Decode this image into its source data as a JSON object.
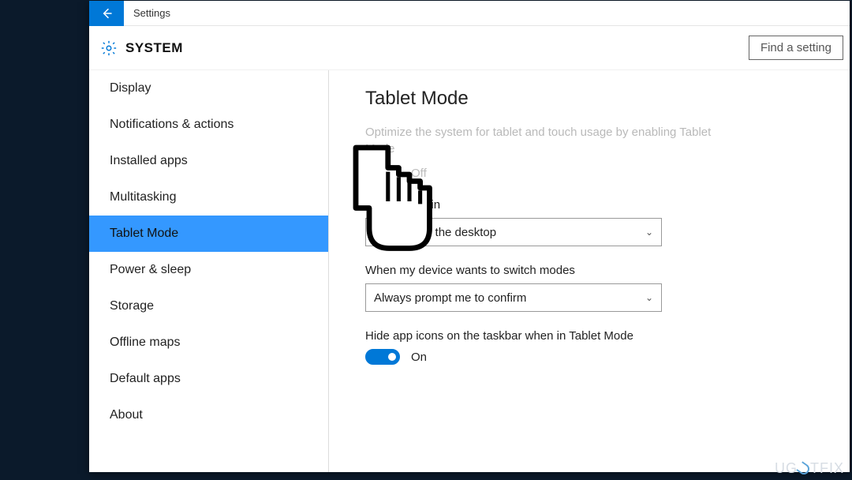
{
  "title_bar": {
    "title": "Settings"
  },
  "header": {
    "title": "SYSTEM",
    "search_label": "Find a setting"
  },
  "sidebar": {
    "items": [
      {
        "label": "Display",
        "active": false
      },
      {
        "label": "Notifications & actions",
        "active": false
      },
      {
        "label": "Installed apps",
        "active": false
      },
      {
        "label": "Multitasking",
        "active": false
      },
      {
        "label": "Tablet Mode",
        "active": true
      },
      {
        "label": "Power & sleep",
        "active": false
      },
      {
        "label": "Storage",
        "active": false
      },
      {
        "label": "Offline maps",
        "active": false
      },
      {
        "label": "Default apps",
        "active": false
      },
      {
        "label": "About",
        "active": false
      }
    ]
  },
  "content": {
    "page_title": "Tablet Mode",
    "description": "Optimize the system for tablet and touch usage by enabling Tablet Mode",
    "toggle1": {
      "state": "off",
      "label": "Off"
    },
    "field1": {
      "label": "When I sign in",
      "value": "Take me to the desktop"
    },
    "field2": {
      "label": "When my device wants to switch modes",
      "value": "Always prompt me to confirm"
    },
    "field3": {
      "label": "Hide app icons on the taskbar when in Tablet Mode"
    },
    "toggle2": {
      "state": "on",
      "label": "On"
    }
  },
  "watermark": "UGETFIX"
}
